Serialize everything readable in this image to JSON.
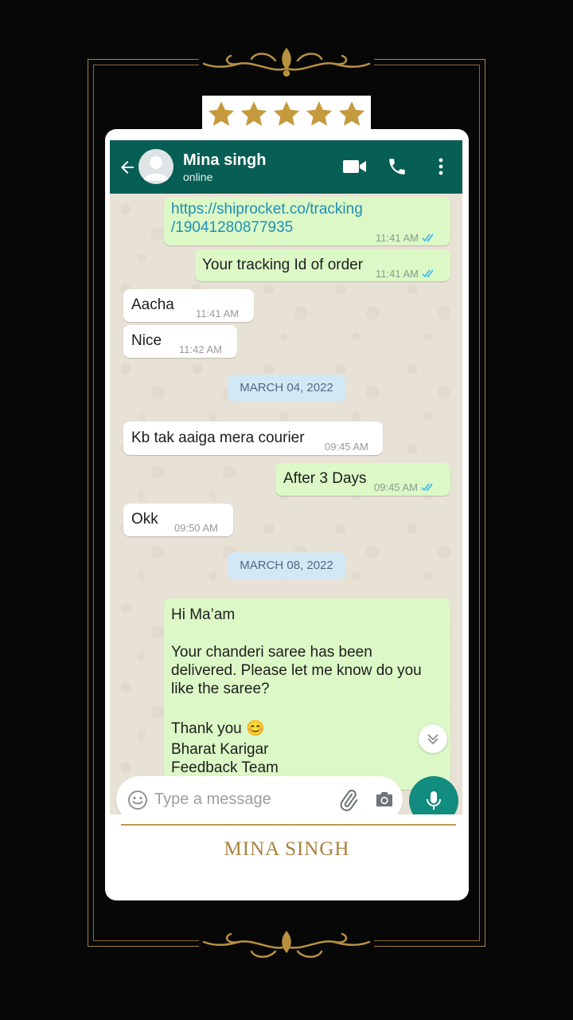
{
  "rating": {
    "stars": 5,
    "max": 5,
    "color": "#c59a3d"
  },
  "header": {
    "contact_name": "Mina singh",
    "status": "online",
    "icons": [
      "back-arrow-icon",
      "avatar",
      "video-call-icon",
      "voice-call-icon",
      "more-vert-icon"
    ],
    "color": "#075e54"
  },
  "messages": [
    {
      "dir": "out",
      "text_line1": "https://shiprocket.co/tracking",
      "text_line2": "/19041280877935",
      "time": "11:41 AM",
      "is_link": true
    },
    {
      "dir": "out",
      "text": "Your tracking Id of order",
      "time": "11:41 AM"
    },
    {
      "dir": "in",
      "text": "Aacha",
      "time": "11:41 AM"
    },
    {
      "dir": "in",
      "text": "Nice",
      "time": "11:42 AM"
    },
    {
      "dir": "date",
      "text": "MARCH 04, 2022"
    },
    {
      "dir": "in",
      "text": "Kb tak aaiga mera courier",
      "time": "09:45 AM"
    },
    {
      "dir": "out",
      "text": "After 3 Days",
      "time": "09:45 AM"
    },
    {
      "dir": "in",
      "text": "Okk",
      "time": "09:50 AM"
    },
    {
      "dir": "date",
      "text": "MARCH 08, 2022"
    },
    {
      "dir": "out",
      "line1": "Hi Ma’am",
      "line2": "Your chanderi saree has been",
      "line3": "delivered. Please let me know do you",
      "line4": "like the saree?",
      "line5": "Thank you 😊",
      "line6": "Bharat Karigar",
      "line7": "Feedback Team"
    }
  ],
  "composer": {
    "placeholder": "Type a message",
    "icons": [
      "emoji-icon",
      "attach-icon",
      "camera-icon",
      "mic-icon"
    ]
  },
  "footer": {
    "signature": "MINA SINGH"
  },
  "colors": {
    "outgoing_bubble": "#dcf8c6",
    "incoming_bubble": "#ffffff",
    "read_ticks": "#34b7f1",
    "mic_button": "#128c7e",
    "gold": "#a8823e"
  }
}
